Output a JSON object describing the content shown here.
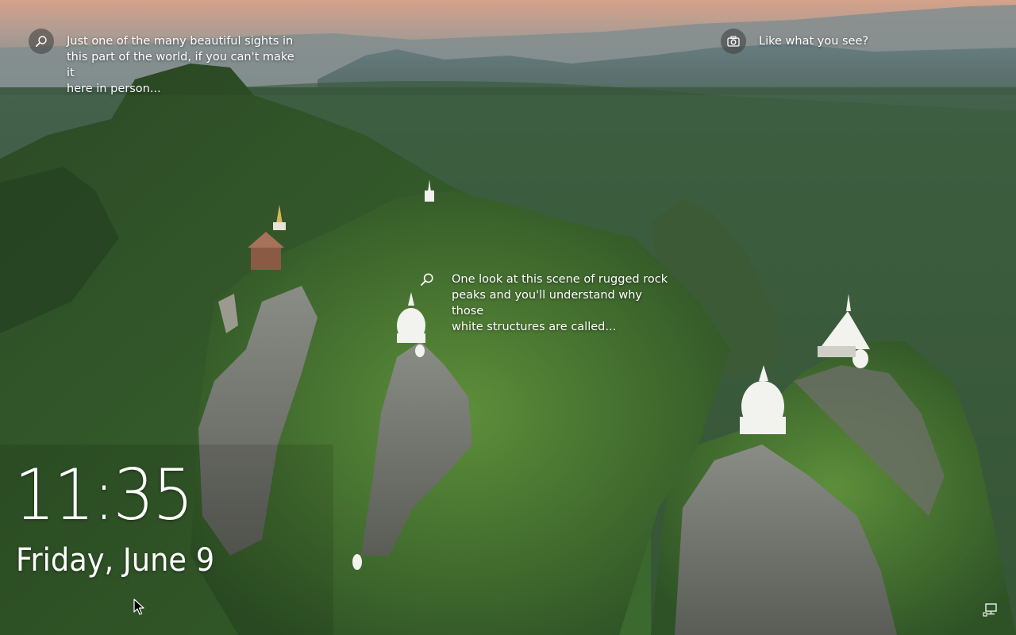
{
  "lockscreen": {
    "hotspots": {
      "top_left": {
        "icon": "search-icon",
        "text": "Just one of the many beautiful sights in\nthis part of the world, if you can't make it\nhere in person..."
      },
      "camera": {
        "icon": "camera-icon",
        "text": "Like what you see?"
      },
      "center": {
        "icon": "search-icon",
        "text": "One look at this scene of rugged rock\npeaks and you'll understand why those\nwhite structures are called..."
      }
    },
    "time": "11:35",
    "date": "Friday, June 9"
  },
  "status": {
    "network_icon": "network-icon"
  },
  "colors": {
    "text": "#ffffff",
    "bubble_bg": "rgba(60,60,60,0.55)",
    "sky_top": "#e8b59a",
    "forest": "#2f5a2c"
  }
}
